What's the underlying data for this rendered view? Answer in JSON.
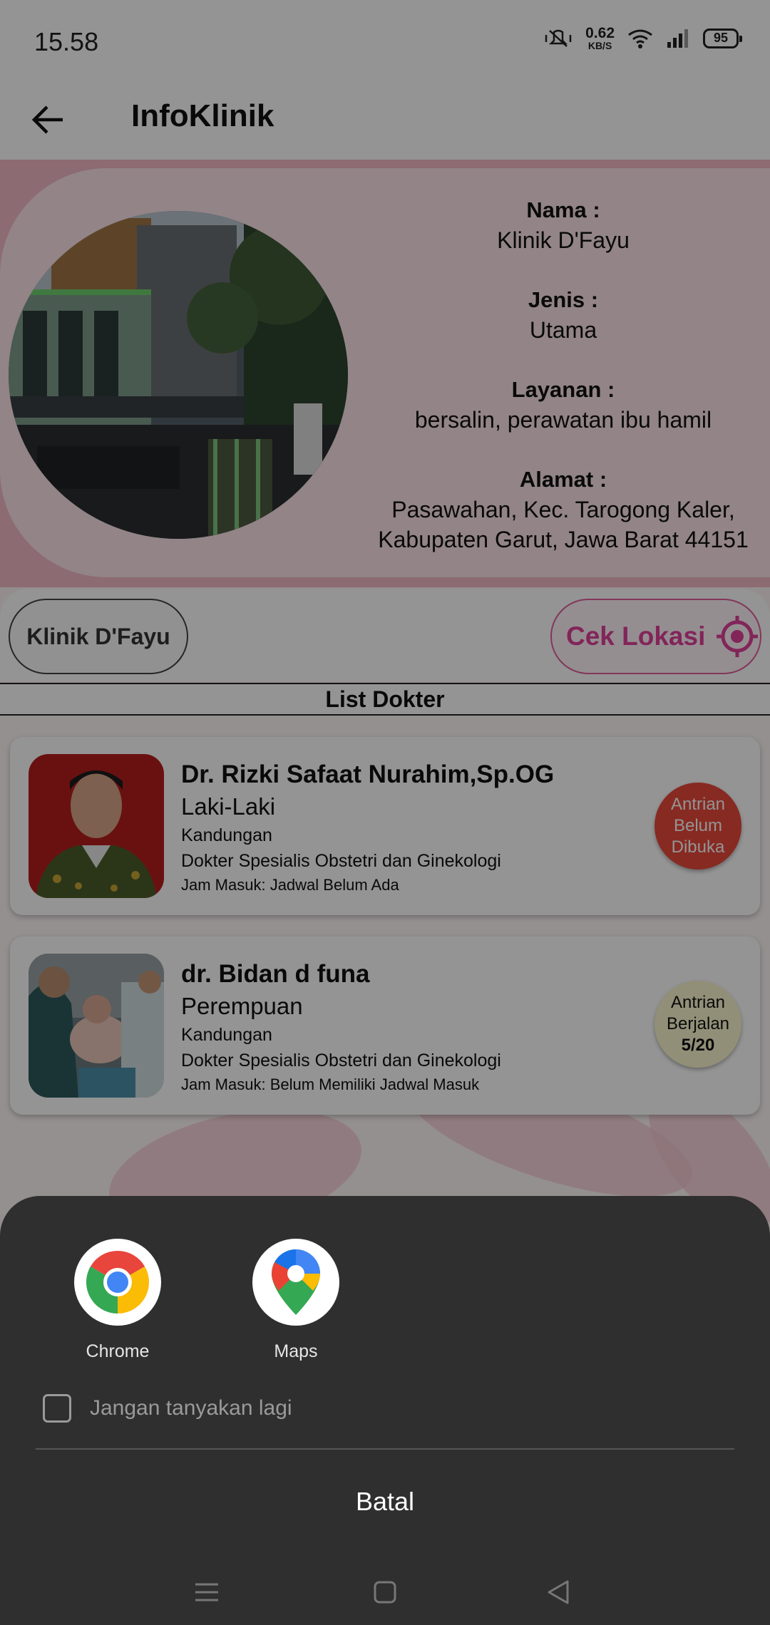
{
  "status_bar": {
    "time": "15.58",
    "net_speed_value": "0.62",
    "net_speed_unit": "KB/S",
    "battery": "95"
  },
  "app_bar": {
    "title": "InfoKlinik"
  },
  "clinic": {
    "name_label": "Nama :",
    "name": "Klinik D'Fayu",
    "type_label": "Jenis :",
    "type": "Utama",
    "service_label": "Layanan :",
    "service": "bersalin, perawatan ibu hamil",
    "address_label": "Alamat :",
    "address_line1": "Pasawahan, Kec. Tarogong Kaler,",
    "address_line2": "Kabupaten Garut, Jawa Barat 44151"
  },
  "actions": {
    "clinic_chip": "Klinik D'Fayu",
    "location_button": "Cek Lokasi"
  },
  "list_header": "List Dokter",
  "doctors": [
    {
      "name": "Dr. Rizki Safaat Nurahim,Sp.OG",
      "gender": "Laki-Laki",
      "specialty": "Kandungan",
      "job": "Dokter Spesialis Obstetri dan Ginekologi",
      "hours": "Jam Masuk: Jadwal Belum Ada",
      "queue_line1": "Antrian",
      "queue_line2": "Belum",
      "queue_line3": "Dibuka",
      "queue_color": "#e8493b"
    },
    {
      "name": "dr. Bidan d funa",
      "gender": "Perempuan",
      "specialty": "Kandungan",
      "job": "Dokter Spesialis Obstetri dan Ginekologi",
      "hours": "Jam Masuk: Belum Memiliki Jadwal Masuk",
      "queue_line1": "Antrian",
      "queue_line2": "Berjalan",
      "queue_line3": "5/20",
      "queue_color": "#fbf6cf"
    }
  ],
  "chooser": {
    "apps": [
      {
        "label": "Chrome",
        "icon": "chrome-icon"
      },
      {
        "label": "Maps",
        "icon": "maps-icon"
      }
    ],
    "remember_label": "Jangan tanyakan lagi",
    "cancel_label": "Batal"
  },
  "nav_bar": {
    "icons": [
      "menu-icon",
      "home-icon",
      "back-triangle-icon"
    ]
  }
}
